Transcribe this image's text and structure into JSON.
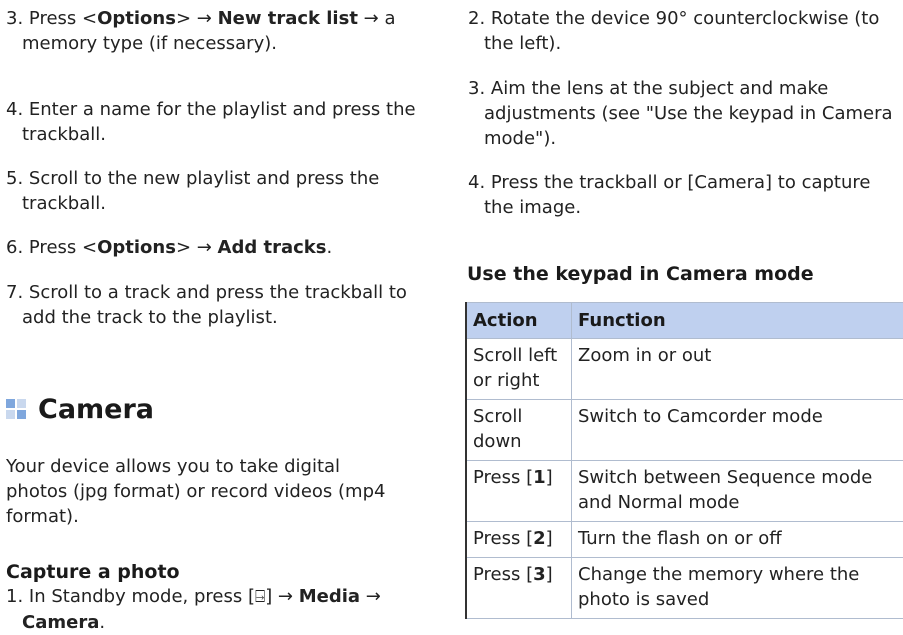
{
  "left_column": {
    "step3": {
      "num": "3. ",
      "t1": "Press <",
      "b1": "Options",
      "t2": "> → ",
      "b2": "New track list",
      "t3": " → a memory type (if necessary)."
    },
    "step4": "4. Enter a name for the playlist and press the trackball.",
    "step5": "5. Scroll to the new playlist and press the trackball.",
    "step6": {
      "t1": "6. Press <",
      "b1": "Options",
      "t2": "> → ",
      "b2": "Add tracks",
      "t3": "."
    },
    "step7": "7. Scroll to a track and press the trackball to add the track to the playlist.",
    "camera_title": "Camera",
    "camera_icon_colors": [
      "#7fa7dd",
      "#c9d8ee",
      "#c9d8ee",
      "#7fa7dd"
    ],
    "camera_intro": "Your device allows you to take digital photos (jpg format) or record videos (mp4 format).",
    "capture_heading": "Capture a photo",
    "capture_step1": {
      "t1": "1. In Standby mode, press [",
      "icon": "⍈",
      "t2": "] → ",
      "b1": "Media",
      "t3": " → ",
      "b2": "Camera",
      "t4": "."
    }
  },
  "right_column": {
    "step2": "2. Rotate the device 90° counterclockwise (to the left).",
    "step3": "3. Aim the lens at the subject and make adjustments (see \"Use the keypad in Camera mode\").",
    "step4": "4. Press the trackball or [Camera] to capture the image.",
    "keypad_heading": "Use the keypad in Camera mode",
    "table": {
      "headers": [
        "Action",
        "Function"
      ],
      "header_color": "#bfd0ef",
      "rows": [
        {
          "action": "Scroll left or right",
          "function": "Zoom in or out"
        },
        {
          "action": "Scroll down",
          "function": "Switch to Camcorder mode"
        },
        {
          "action_pre": "Press [",
          "action_key": "1",
          "action_post": "]",
          "function": "Switch between Sequence mode and Normal mode"
        },
        {
          "action_pre": "Press [",
          "action_key": "2",
          "action_post": "]",
          "function": "Turn the flash on or off"
        },
        {
          "action_pre": "Press [",
          "action_key": "3",
          "action_post": "]",
          "function": "Change the memory where the photo is saved"
        }
      ]
    }
  }
}
